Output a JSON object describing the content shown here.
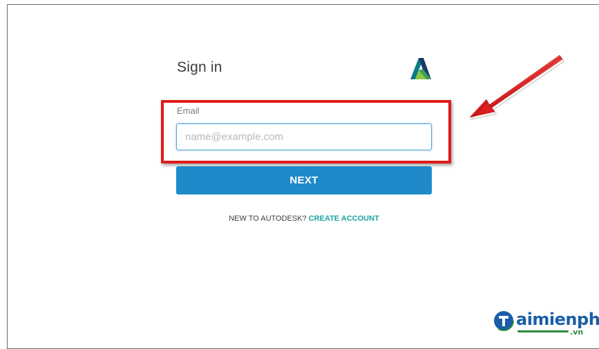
{
  "signin": {
    "title": "Sign in",
    "email_label": "Email",
    "email_placeholder": "name@example.com",
    "email_value": "",
    "next_label": "NEXT",
    "new_prompt": "NEW TO AUTODESK? ",
    "create_account_label": "CREATE ACCOUNT"
  },
  "logo": {
    "icon": "autodesk-logo"
  },
  "watermark": {
    "text": "aimienphi",
    "suffix": ".vn"
  },
  "colors": {
    "primary_button": "#1f8ac9",
    "link": "#1aa5a0",
    "highlight": "#e01b1b",
    "input_border": "#4fa3d8"
  }
}
